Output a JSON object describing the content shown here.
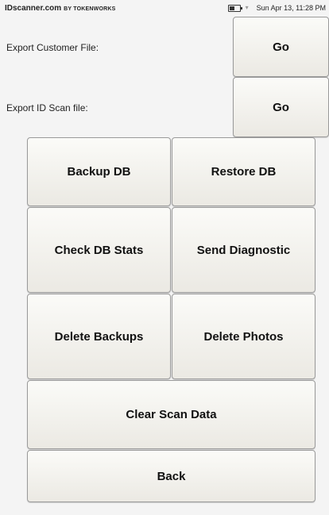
{
  "statusbar": {
    "brand": "IDscanner.com",
    "brand_suffix": "BY TOKENWORKS",
    "datetime": "Sun Apr 13, 11:28 PM",
    "battery_icon": "battery-icon",
    "wifi_icon": "wifi-icon"
  },
  "export_customer": {
    "label": "Export Customer File:",
    "button": "Go"
  },
  "export_idscan": {
    "label": "Export ID Scan file:",
    "button": "Go"
  },
  "buttons": {
    "backup_db": "Backup DB",
    "restore_db": "Restore DB",
    "check_db_stats": "Check DB Stats",
    "send_diagnostic": "Send Diagnostic",
    "delete_backups": "Delete Backups",
    "delete_photos": "Delete Photos",
    "clear_scan_data": "Clear Scan Data",
    "back": "Back"
  }
}
